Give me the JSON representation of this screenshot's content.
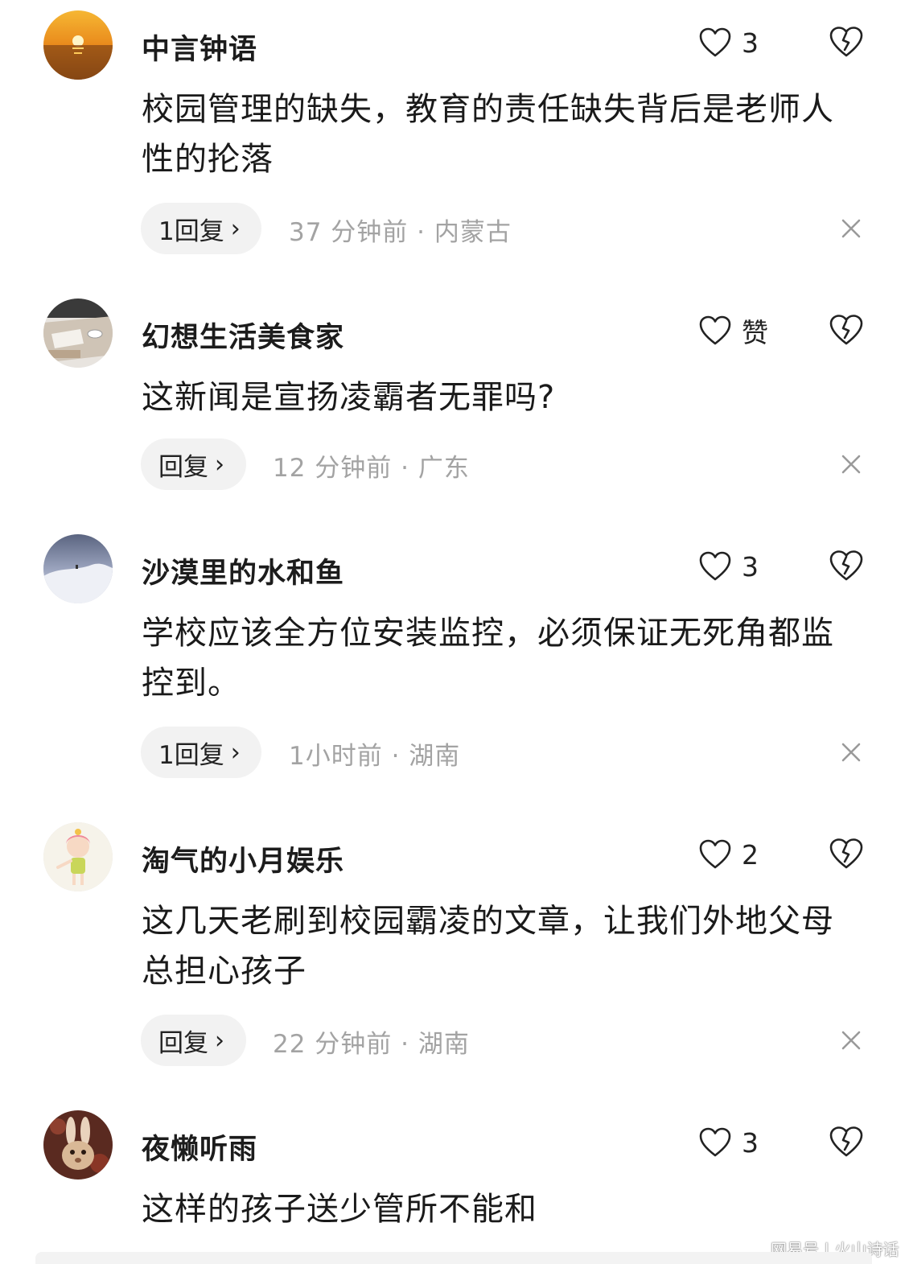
{
  "comments": [
    {
      "username": "中言钟语",
      "likes": "3",
      "text": "校园管理的缺失，教育的责任缺失背后是老师人性的抡落",
      "reply_label": "1回复",
      "meta": "37 分钟前 · 内蒙古",
      "avatar": "sunset-avatar"
    },
    {
      "username": "幻想生活美食家",
      "likes": "赞",
      "text": "这新闻是宣扬凌霸者无罪吗?",
      "reply_label": "回复",
      "meta": "12 分钟前 · 广东",
      "avatar": "table-avatar"
    },
    {
      "username": "沙漠里的水和鱼",
      "likes": "3",
      "text": "学校应该全方位安装监控，必须保证无死角都监控到。",
      "reply_label": "1回复",
      "meta": "1小时前 · 湖南",
      "avatar": "snow-avatar"
    },
    {
      "username": "淘气的小月娱乐",
      "likes": "2",
      "text": "这几天老刷到校园霸凌的文章，让我们外地父母总担心孩子",
      "reply_label": "回复",
      "meta": "22 分钟前 · 湖南",
      "avatar": "cartoon-girl-avatar"
    },
    {
      "username": "夜懒听雨",
      "likes": "3",
      "text": "这样的孩子送少管所不能和",
      "reply_label": "",
      "meta": "",
      "avatar": "rabbit-avatar"
    }
  ],
  "chevron": "›",
  "watermark": "网易号 | 火山诗话",
  "colors": {
    "meta_gray": "#a3a3a3",
    "reply_bg": "#f2f2f2"
  }
}
